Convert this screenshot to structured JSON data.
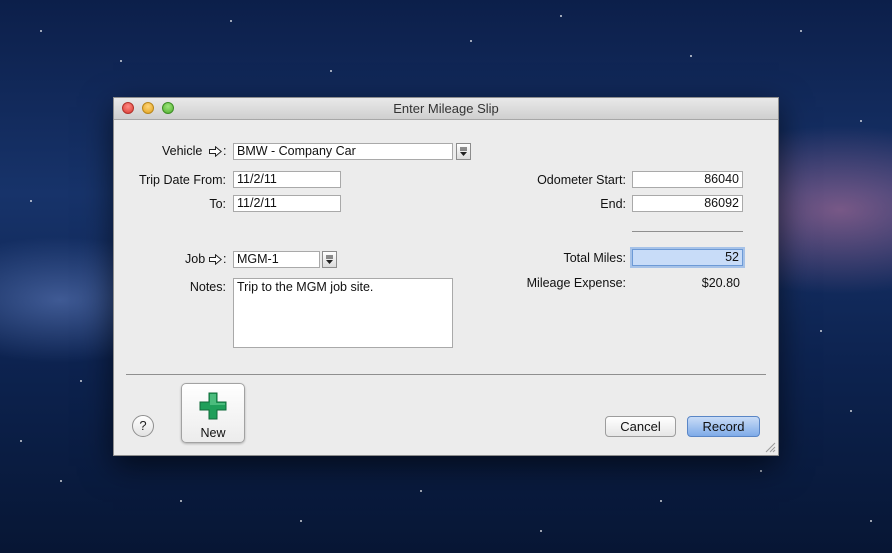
{
  "window": {
    "title": "Enter Mileage Slip"
  },
  "form": {
    "vehicle_label": "Vehicle",
    "vehicle_arrow_suffix": ":",
    "vehicle_value": "BMW - Company Car",
    "trip_date_from_label": "Trip Date From:",
    "trip_date_from_value": "11/2/11",
    "to_label": "To:",
    "to_value": "11/2/11",
    "job_label": "Job",
    "job_arrow_suffix": ":",
    "job_value": "MGM-1",
    "notes_label": "Notes:",
    "notes_value": "Trip to the MGM job site.",
    "odometer_start_label": "Odometer Start:",
    "odometer_start_value": "86040",
    "end_label": "End:",
    "end_value": "86092",
    "total_miles_label": "Total Miles:",
    "total_miles_value": "52",
    "mileage_expense_label": "Mileage Expense:",
    "mileage_expense_value": "$20.80"
  },
  "footer": {
    "help_label": "?",
    "new_label": "New",
    "cancel_label": "Cancel",
    "record_label": "Record"
  },
  "icons": {
    "arrow": "right-arrow-icon",
    "dropdown": "dropdown-icon",
    "new": "plus-icon",
    "help": "question-mark-icon",
    "resize": "resize-grip-icon"
  },
  "colors": {
    "highlight_field": "#c8dcf8",
    "primary_button": "#7fabe8",
    "plus_green": "#1f9f5a"
  }
}
